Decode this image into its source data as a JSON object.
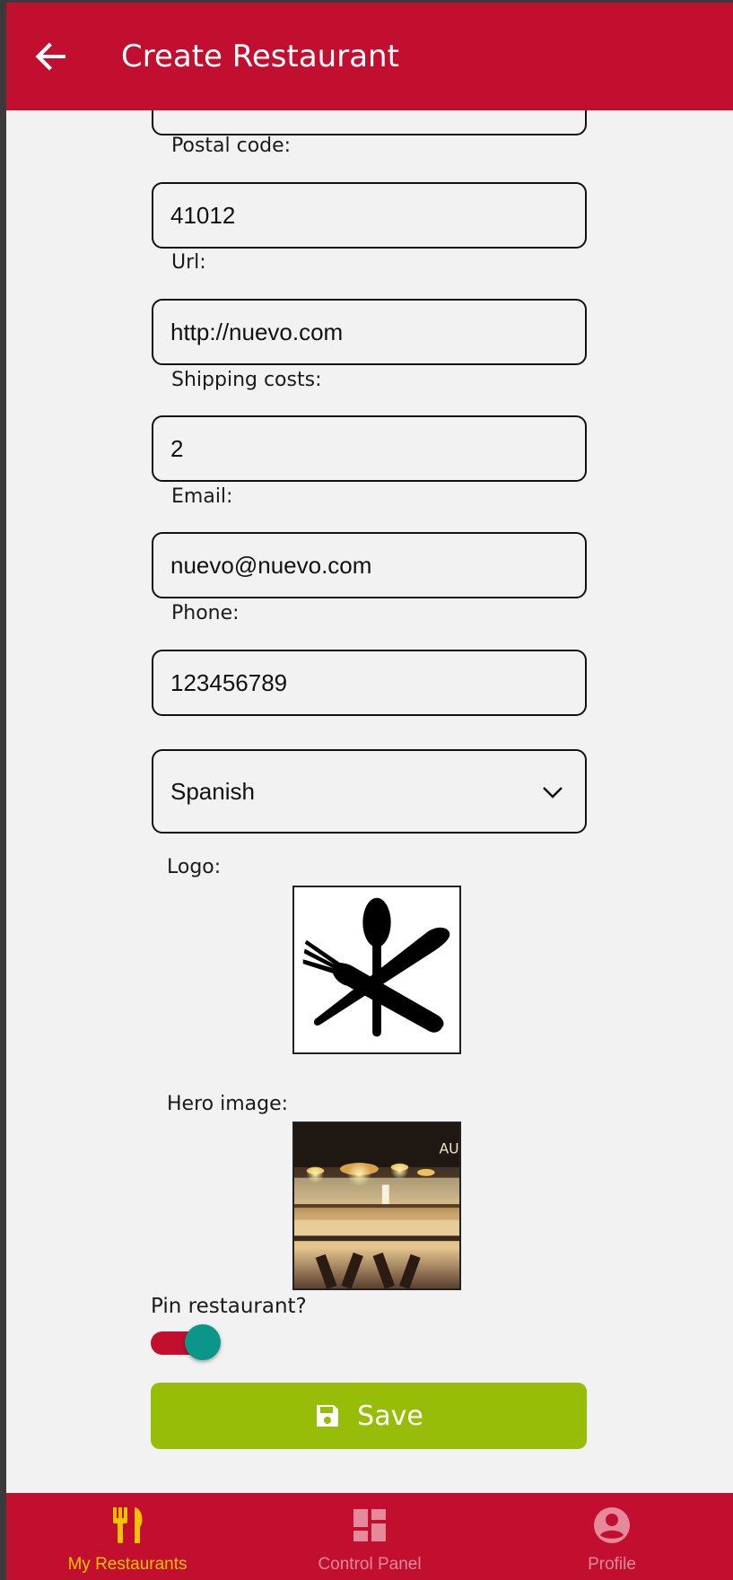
{
  "appbar": {
    "title": "Create Restaurant",
    "back_icon": "arrow-left-icon"
  },
  "form": {
    "partial_field_value": "",
    "postal_code": {
      "label": "Postal code:",
      "value": "41012"
    },
    "url": {
      "label": "Url:",
      "value": "http://nuevo.com"
    },
    "shipping_costs": {
      "label": "Shipping costs:",
      "value": "2"
    },
    "email": {
      "label": "Email:",
      "value": "nuevo@nuevo.com"
    },
    "phone": {
      "label": "Phone:",
      "value": "123456789"
    },
    "category": {
      "selected": "Spanish"
    },
    "logo": {
      "label": "Logo:",
      "image": "cutlery-logo"
    },
    "hero": {
      "label": "Hero image:",
      "image": "restaurant-interior-photo",
      "sign_text": "AU"
    },
    "pin": {
      "label": "Pin restaurant?",
      "on": true
    },
    "save": {
      "label": "Save",
      "icon": "floppy-disk-icon"
    }
  },
  "tabbar": {
    "tabs": [
      {
        "label": "My Restaurants",
        "icon": "cutlery-icon",
        "active": true
      },
      {
        "label": "Control Panel",
        "icon": "dashboard-icon",
        "active": false
      },
      {
        "label": "Profile",
        "icon": "account-circle-icon",
        "active": false
      }
    ]
  },
  "colors": {
    "primary": "#c20f2f",
    "save_button": "#97bd08",
    "toggle_knob": "#0a9688",
    "active_tab": "#f6c200",
    "inactive_tab": "#e58a9b",
    "background": "#f2f2f2"
  }
}
